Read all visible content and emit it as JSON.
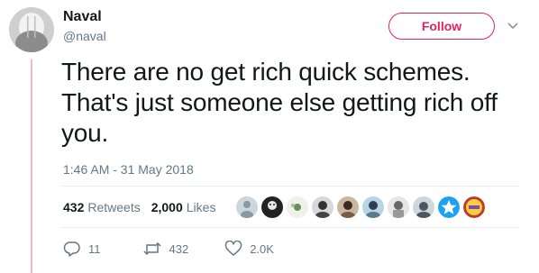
{
  "user": {
    "name": "Naval",
    "handle": "@naval",
    "follow_label": "Follow"
  },
  "tweet": {
    "text": "There are no get rich quick schemes. That's just someone else getting rich off you.",
    "timestamp": "1:46 AM - 31 May 2018"
  },
  "stats": {
    "retweets_count": "432",
    "retweets_label": "Retweets",
    "likes_count": "2,000",
    "likes_label": "Likes"
  },
  "actions": {
    "reply_count": "11",
    "retweet_count": "432",
    "like_count": "2.0K"
  },
  "colors": {
    "accent": "#e0245e",
    "thread_line": "#f5b5d0",
    "secondary_text": "#657786",
    "liker_star": "#1da1f2"
  },
  "icons": {
    "reply": "reply-icon",
    "retweet": "retweet-icon",
    "like": "heart-icon",
    "menu": "chevron-down-icon"
  }
}
